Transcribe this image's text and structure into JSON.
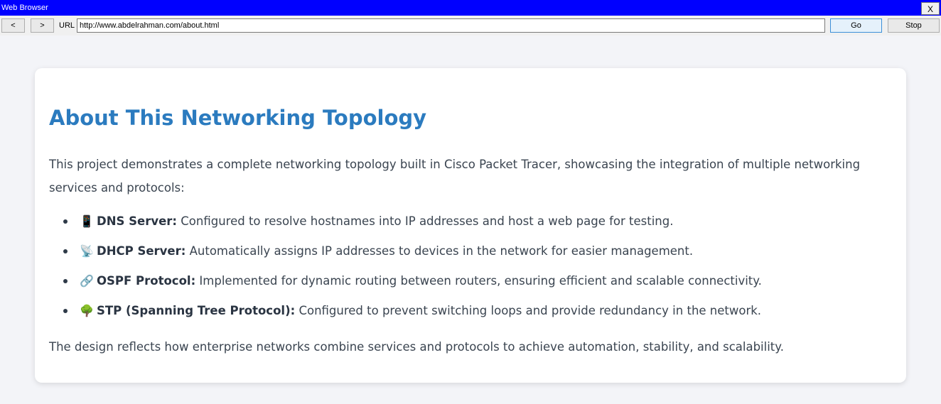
{
  "window": {
    "title": "Web Browser",
    "close_label": "X"
  },
  "toolbar": {
    "back_label": "<",
    "forward_label": ">",
    "url_label": "URL",
    "url_value": "http://www.abdelrahman.com/about.html",
    "go_label": "Go",
    "stop_label": "Stop"
  },
  "page": {
    "heading": "About This Networking Topology",
    "intro": "This project demonstrates a complete networking topology built in Cisco Packet Tracer, showcasing the integration of multiple networking services and protocols:",
    "features": [
      {
        "icon": "📱",
        "icon_name": "phone-icon",
        "name": "DNS Server:",
        "description": " Configured to resolve hostnames into IP addresses and host a web page for testing."
      },
      {
        "icon": "📡",
        "icon_name": "satellite-dish-icon",
        "name": "DHCP Server:",
        "description": " Automatically assigns IP addresses to devices in the network for easier management."
      },
      {
        "icon": "🔗",
        "icon_name": "link-icon",
        "name": "OSPF Protocol:",
        "description": " Implemented for dynamic routing between routers, ensuring efficient and scalable connectivity."
      },
      {
        "icon": "🌳",
        "icon_name": "tree-icon",
        "name": "STP (Spanning Tree Protocol):",
        "description": " Configured to prevent switching loops and provide redundancy in the network."
      }
    ],
    "outro": "The design reflects how enterprise networks combine services and protocols to achieve automation, stability, and scalability."
  },
  "colors": {
    "titlebar": "#0000ff",
    "heading": "#2b7bbf",
    "body_text": "#3a4450",
    "background": "#f3f4f8"
  }
}
